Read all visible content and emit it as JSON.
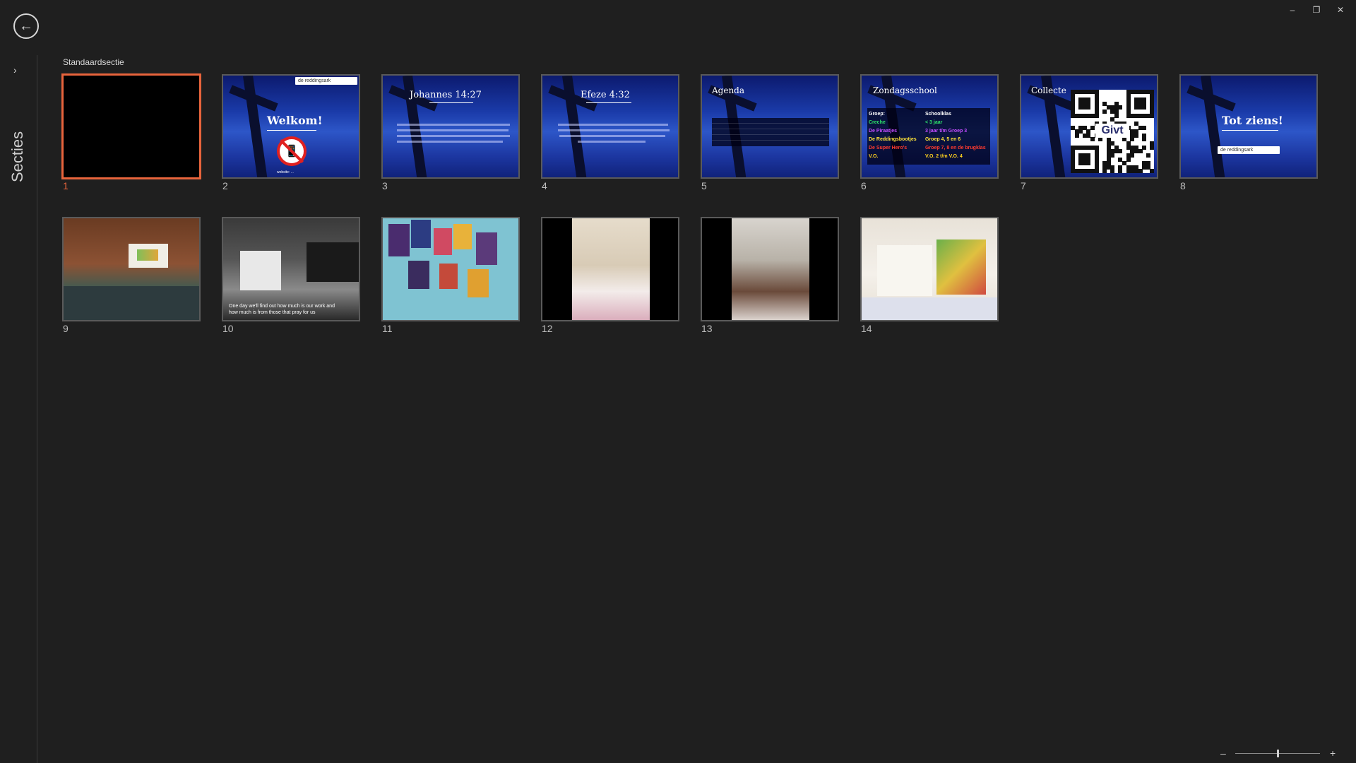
{
  "window": {
    "minimize": "–",
    "restore": "❐",
    "close": "✕"
  },
  "back": {
    "icon": "←"
  },
  "sidepanel": {
    "chevron": "›",
    "label": "Secties"
  },
  "section": {
    "title": "Standaardsectie"
  },
  "slides": [
    {
      "number": "1"
    },
    {
      "number": "2",
      "title": "Welkom!",
      "logo": "de reddingsark",
      "footer": "website: ..."
    },
    {
      "number": "3",
      "title": "Johannes 14:27"
    },
    {
      "number": "4",
      "title": "Efeze 4:32"
    },
    {
      "number": "5",
      "title": "Agenda"
    },
    {
      "number": "6",
      "title": "Zondagsschool",
      "rows": [
        {
          "group": "Groep:",
          "class": "Schoolklas",
          "color": "#ffffff"
        },
        {
          "group": "Creche",
          "class": "< 3 jaar",
          "color": "#2ee26b"
        },
        {
          "group": "De Piraatjes",
          "class": "3 jaar t/m Groep 3",
          "color": "#c44dff"
        },
        {
          "group": "De Reddingsbootjes",
          "class": "Groep 4, 5 en 6",
          "color": "#ffe53a"
        },
        {
          "group": "De Super Hero's",
          "class": "Groep 7, 8 en de brugklas",
          "color": "#ff3b2f"
        },
        {
          "group": "V.O.",
          "class": "V.O. 2 t/m V.O. 4",
          "color": "#ffd21e"
        }
      ]
    },
    {
      "number": "7",
      "title": "Collecte",
      "qr_label": "Givt"
    },
    {
      "number": "8",
      "title": "Tot ziens!",
      "logo": "de reddingsark"
    },
    {
      "number": "9"
    },
    {
      "number": "10",
      "caption": "One day we'll find out how much is our work and how much is from those that pray for us"
    },
    {
      "number": "11"
    },
    {
      "number": "12"
    },
    {
      "number": "13"
    },
    {
      "number": "14"
    }
  ],
  "zoom": {
    "minus": "–",
    "plus": "+",
    "level": 0.5
  },
  "colors": {
    "accent": "#e8643c",
    "background": "#1f1f1f"
  }
}
